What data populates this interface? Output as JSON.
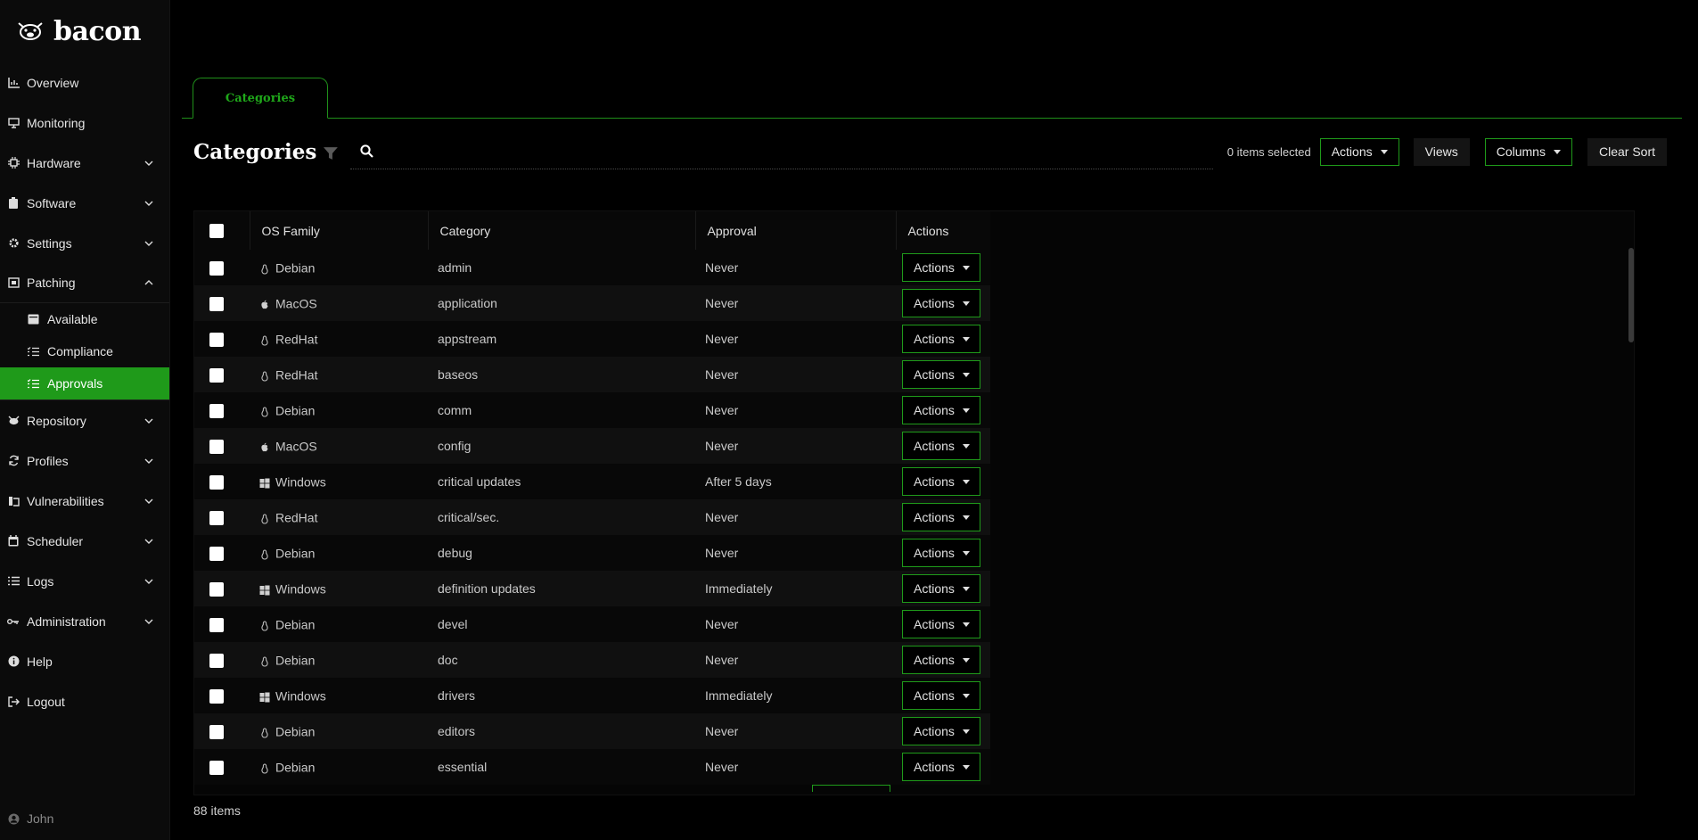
{
  "brand": {
    "name": "bacon"
  },
  "sidebar": {
    "items": [
      {
        "label": "Overview",
        "icon": "chart-icon"
      },
      {
        "label": "Monitoring",
        "icon": "monitor-icon"
      },
      {
        "label": "Hardware",
        "icon": "chip-icon"
      },
      {
        "label": "Software",
        "icon": "clipboard-icon"
      },
      {
        "label": "Settings",
        "icon": "gear-icon"
      },
      {
        "label": "Patching",
        "icon": "patch-icon"
      },
      {
        "label": "Repository",
        "icon": "repository-icon"
      },
      {
        "label": "Profiles",
        "icon": "refresh-icon"
      },
      {
        "label": "Vulnerabilities",
        "icon": "bug-icon"
      },
      {
        "label": "Scheduler",
        "icon": "calendar-icon"
      },
      {
        "label": "Logs",
        "icon": "list-icon"
      },
      {
        "label": "Administration",
        "icon": "key-icon"
      },
      {
        "label": "Help",
        "icon": "info-icon"
      },
      {
        "label": "Logout",
        "icon": "logout-icon"
      }
    ],
    "patching_sub": [
      {
        "label": "Available",
        "icon": "inbox-icon"
      },
      {
        "label": "Compliance",
        "icon": "checklist-icon"
      },
      {
        "label": "Approvals",
        "icon": "checklist-icon"
      }
    ],
    "user": "John"
  },
  "tabs": [
    {
      "label": "Categories"
    }
  ],
  "toolbar": {
    "title": "Categories",
    "search_placeholder": "",
    "selected": "0 items selected",
    "actions_label": "Actions",
    "views_label": "Views",
    "columns_label": "Columns",
    "clear_sort_label": "Clear Sort"
  },
  "table": {
    "headers": {
      "os_family": "OS Family",
      "category": "Category",
      "approval": "Approval",
      "actions": "Actions"
    },
    "row_action_label": "Actions",
    "rows": [
      {
        "os": "Debian",
        "os_icon": "linux-icon",
        "category": "admin",
        "approval": "Never"
      },
      {
        "os": "MacOS",
        "os_icon": "apple-icon",
        "category": "application",
        "approval": "Never"
      },
      {
        "os": "RedHat",
        "os_icon": "linux-icon",
        "category": "appstream",
        "approval": "Never"
      },
      {
        "os": "RedHat",
        "os_icon": "linux-icon",
        "category": "baseos",
        "approval": "Never"
      },
      {
        "os": "Debian",
        "os_icon": "linux-icon",
        "category": "comm",
        "approval": "Never"
      },
      {
        "os": "MacOS",
        "os_icon": "apple-icon",
        "category": "config",
        "approval": "Never"
      },
      {
        "os": "Windows",
        "os_icon": "windows-icon",
        "category": "critical updates",
        "approval": "After 5 days"
      },
      {
        "os": "RedHat",
        "os_icon": "linux-icon",
        "category": "critical/sec.",
        "approval": "Never"
      },
      {
        "os": "Debian",
        "os_icon": "linux-icon",
        "category": "debug",
        "approval": "Never"
      },
      {
        "os": "Windows",
        "os_icon": "windows-icon",
        "category": "definition updates",
        "approval": "Immediately"
      },
      {
        "os": "Debian",
        "os_icon": "linux-icon",
        "category": "devel",
        "approval": "Never"
      },
      {
        "os": "Debian",
        "os_icon": "linux-icon",
        "category": "doc",
        "approval": "Never"
      },
      {
        "os": "Windows",
        "os_icon": "windows-icon",
        "category": "drivers",
        "approval": "Immediately"
      },
      {
        "os": "Debian",
        "os_icon": "linux-icon",
        "category": "editors",
        "approval": "Never"
      },
      {
        "os": "Debian",
        "os_icon": "linux-icon",
        "category": "essential",
        "approval": "Never"
      }
    ]
  },
  "footer": {
    "item_count": "88 items"
  },
  "colors": {
    "accent": "#1f9a1a",
    "background": "#000000",
    "sidebar": "#0b0b0b"
  }
}
